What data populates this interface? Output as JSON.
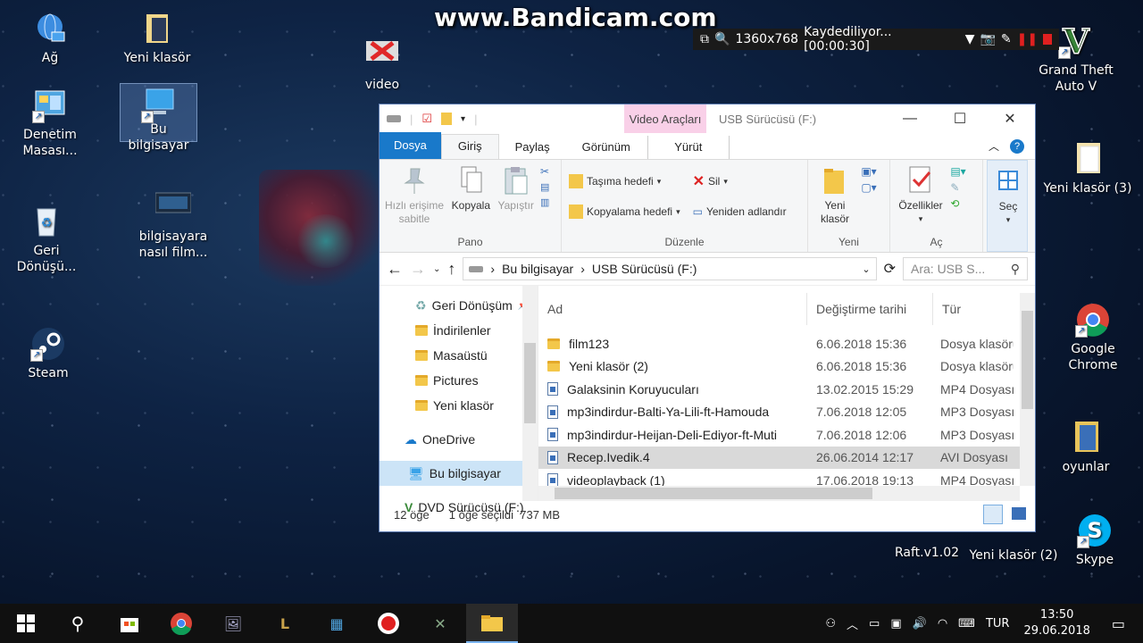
{
  "watermark": "www.Bandicam.com",
  "bandicam": {
    "resolution": "1360x768",
    "status": "Kaydediliyor... [00:00:30]"
  },
  "desktop": {
    "icons": [
      {
        "label": "Ağ",
        "icon": "network-icon"
      },
      {
        "label": "Yeni klasör",
        "icon": "folder-icon"
      },
      {
        "label": "video",
        "icon": "video-icon"
      },
      {
        "label": "Bu bilgisayar",
        "icon": "computer-icon"
      },
      {
        "label": "Denetim Masası...",
        "icon": "control-panel-icon"
      },
      {
        "label": "bilgisayara nasıl film...",
        "icon": "video-file-icon"
      },
      {
        "label": "Geri Dönüşü...",
        "icon": "recycle-bin-icon"
      },
      {
        "label": "Steam",
        "icon": "steam-icon"
      },
      {
        "label": "Grand Theft Auto V",
        "icon": "gta-icon"
      },
      {
        "label": "Yeni klasör (3)",
        "icon": "folder-icon"
      },
      {
        "label": "Google Chrome",
        "icon": "chrome-icon"
      },
      {
        "label": "oyunlar",
        "icon": "folder-icon"
      },
      {
        "label": "Raft.v1.02",
        "icon": "folder-icon"
      },
      {
        "label": "Yeni klasör (2)",
        "icon": "folder-icon"
      },
      {
        "label": "Skype",
        "icon": "skype-icon"
      }
    ]
  },
  "explorer": {
    "context_tab": "Video Araçları",
    "title": "USB Sürücüsü (F:)",
    "tabs": [
      "Dosya",
      "Giriş",
      "Paylaş",
      "Görünüm",
      "Yürüt"
    ],
    "ribbon": {
      "pano": {
        "label": "Pano",
        "pin": "Hızlı erişime sabitle",
        "copy": "Kopyala",
        "paste": "Yapıştır"
      },
      "duzenle": {
        "label": "Düzenle",
        "move": "Taşıma hedefi",
        "copyto": "Kopyalama hedefi",
        "delete": "Sil",
        "rename": "Yeniden adlandır"
      },
      "yeni": {
        "label": "Yeni",
        "newfolder": "Yeni klasör"
      },
      "ac": {
        "label": "Aç",
        "props": "Özellikler"
      },
      "sec": {
        "label": "Seç"
      }
    },
    "address": {
      "parts": [
        "Bu bilgisayar",
        "USB Sürücüsü (F:)"
      ],
      "search_placeholder": "Ara: USB S..."
    },
    "nav": [
      "Geri Dönüşüm",
      "İndirilenler",
      "Masaüstü",
      "Pictures",
      "Yeni klasör",
      "OneDrive",
      "Bu bilgisayar",
      "DVD Sürücüsü (F:)"
    ],
    "columns": [
      "Ad",
      "Değiştirme tarihi",
      "Tür"
    ],
    "files": [
      {
        "name": "film123",
        "date": "6.06.2018 15:36",
        "type": "Dosya klasörü",
        "kind": "folder"
      },
      {
        "name": "Yeni klasör (2)",
        "date": "6.06.2018 15:36",
        "type": "Dosya klasörü",
        "kind": "folder"
      },
      {
        "name": "Galaksinin Koruyucuları",
        "date": "13.02.2015 15:29",
        "type": "MP4 Dosyası",
        "kind": "file"
      },
      {
        "name": "mp3indirdur-Balti-Ya-Lili-ft-Hamouda",
        "date": "7.06.2018 12:05",
        "type": "MP3 Dosyası",
        "kind": "file"
      },
      {
        "name": "mp3indirdur-Heijan-Deli-Ediyor-ft-Muti",
        "date": "7.06.2018 12:06",
        "type": "MP3 Dosyası",
        "kind": "file"
      },
      {
        "name": "Recep.Ivedik.4",
        "date": "26.06.2014 12:17",
        "type": "AVI Dosyası",
        "kind": "file"
      },
      {
        "name": "videoplayback (1)",
        "date": "17.06.2018 19:13",
        "type": "MP4 Dosyası",
        "kind": "file"
      }
    ],
    "status": {
      "count": "12 öğe",
      "selection": "1 öğe seçildi  737 MB"
    }
  },
  "taskbar": {
    "lang": "TUR",
    "time": "13:50",
    "date": "29.06.2018"
  }
}
